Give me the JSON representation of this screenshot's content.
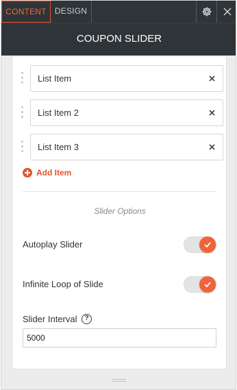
{
  "tabs": {
    "content": "CONTENT",
    "design": "DESIGN"
  },
  "header": {
    "title": "COUPON SLIDER"
  },
  "list": {
    "items": [
      {
        "label": "List Item"
      },
      {
        "label": "List Item 2"
      },
      {
        "label": "List Item 3"
      }
    ],
    "add_label": "Add Item"
  },
  "slider_options": {
    "section_title": "Slider Options",
    "autoplay": {
      "label": "Autoplay Slider",
      "enabled": true
    },
    "infinite_loop": {
      "label": "Infinite Loop of Slide",
      "enabled": true
    },
    "interval": {
      "label": "Slider Interval",
      "value": "5000",
      "help": "?"
    }
  },
  "icons": {
    "settings": "gear-icon",
    "close": "close-icon",
    "remove": "close-icon",
    "add": "plus-circle-icon",
    "drag": "drag-handle-icon",
    "check": "check-icon"
  },
  "colors": {
    "accent": "#e8542a",
    "header_bg": "#2f3438",
    "panel_bg": "#ececec"
  }
}
